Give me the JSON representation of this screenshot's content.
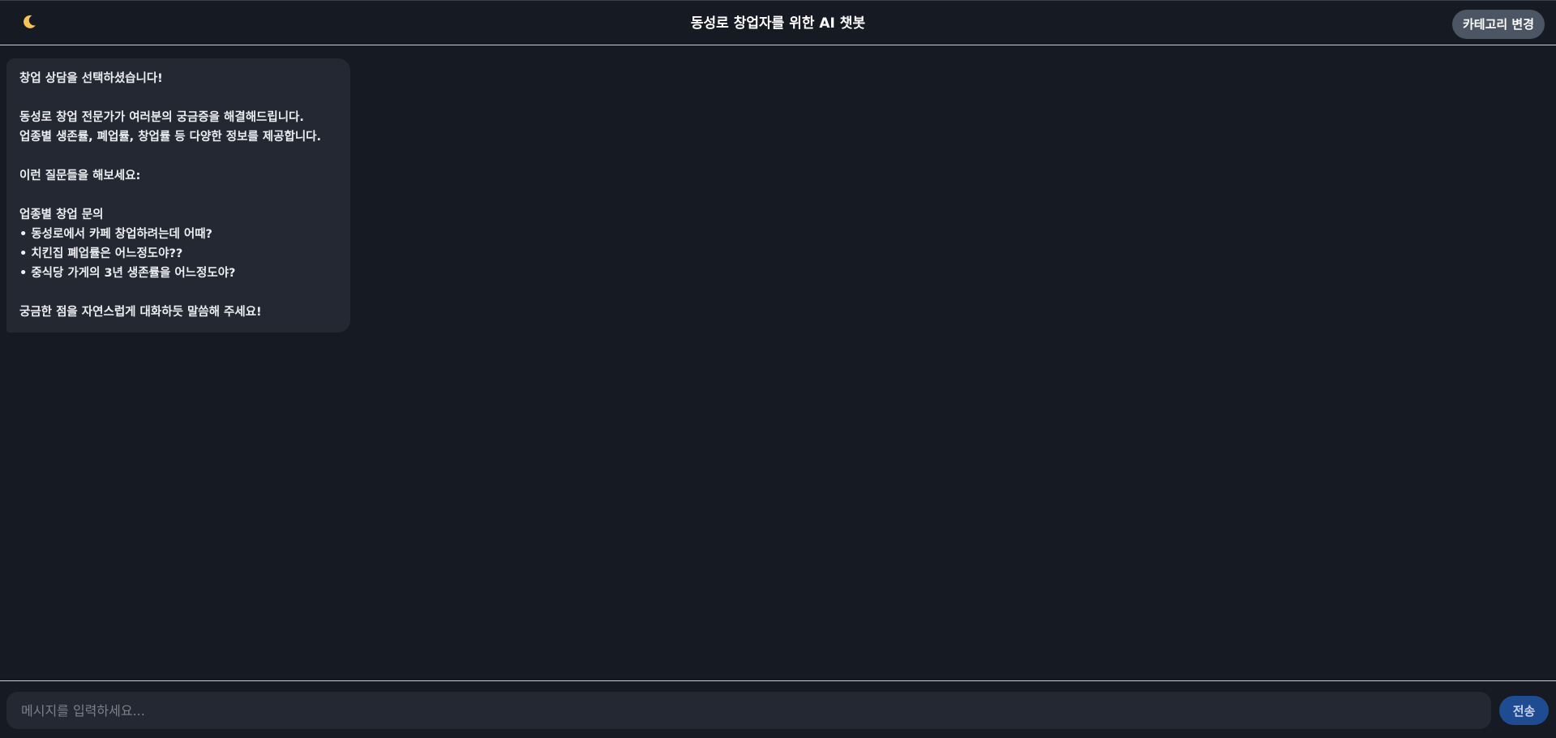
{
  "header": {
    "theme_icon": "moon-icon",
    "title": "동성로 창업자를 위한 AI 챗봇",
    "category_button_label": "카테고리 변경"
  },
  "messages": [
    {
      "role": "bot",
      "lines": [
        "창업 상담을 선택하셨습니다!",
        "",
        "동성로 창업 전문가가 여러분의 궁금증을 해결해드립니다.",
        "업종별 생존률, 폐업률, 창업률 등 다양한 정보를 제공합니다.",
        "",
        "이런 질문들을 해보세요:",
        "",
        "업종별 창업 문의",
        "• 동성로에서 카페 창업하려는데 어때?",
        "• 치킨집 폐업률은 어느정도야??",
        "• 중식당 가게의 3년 생존률을 어느정도야?",
        "",
        "궁금한 점을 자연스럽게 대화하듯 말씀해 주세요!"
      ]
    }
  ],
  "composer": {
    "value": "",
    "placeholder": "메시지를 입력하세요...",
    "send_label": "전송"
  },
  "colors": {
    "background": "#161a22",
    "bubble": "#242832",
    "category_button": "#4b5563",
    "send_button": "#1e4b91",
    "moon": "#f5c451"
  }
}
